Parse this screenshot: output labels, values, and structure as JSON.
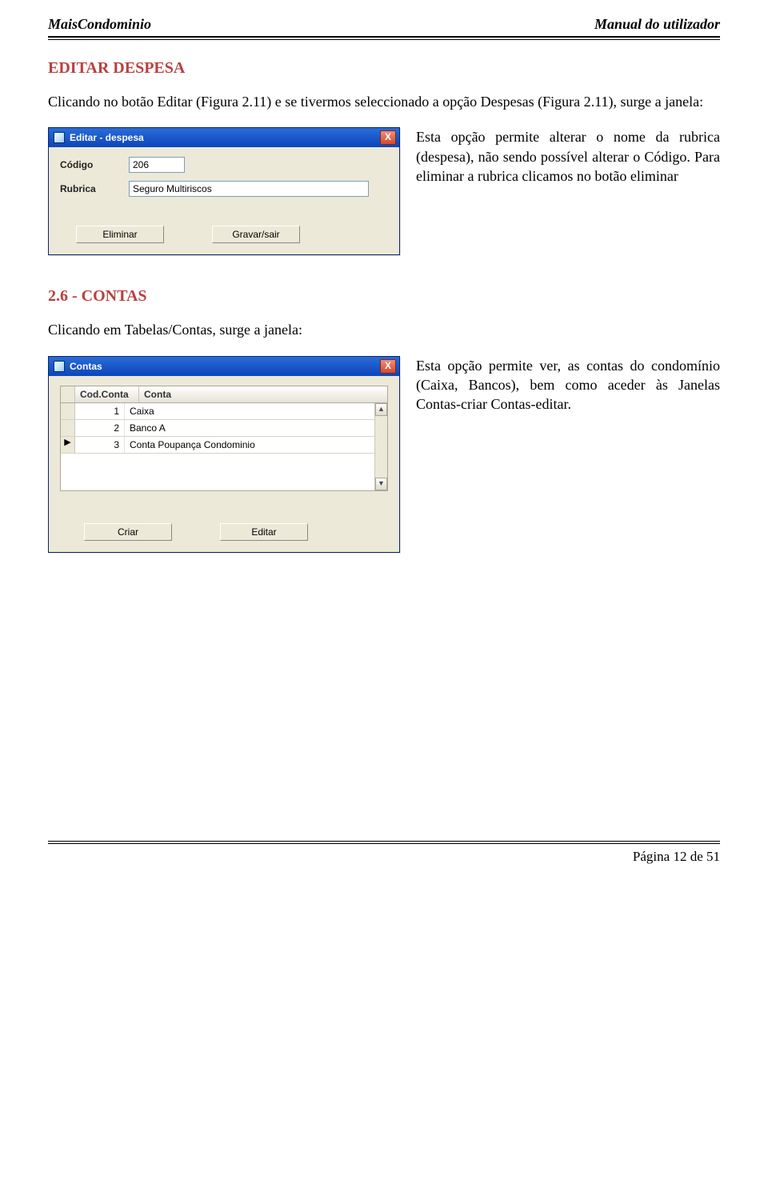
{
  "header": {
    "left": "MaisCondominio",
    "right": "Manual do utilizador"
  },
  "section1": {
    "title": "EDITAR DESPESA",
    "intro": "Clicando no botão Editar (Figura 2.11) e se tivermos seleccionado a opção Despesas (Figura 2.11), surge a janela:"
  },
  "editDialog": {
    "title": "Editar - despesa",
    "close_glyph": "X",
    "codigo_label": "Código",
    "codigo_value": "206",
    "rubrica_label": "Rubrica",
    "rubrica_value": "Seguro Multiriscos",
    "btn_eliminar": "Eliminar",
    "btn_gravar": "Gravar/sair"
  },
  "section1_side": "Esta opção permite alterar o nome da rubrica (despesa), não sendo possível alterar o Código.\nPara eliminar a rubrica clicamos no botão eliminar",
  "section2": {
    "title": "2.6 - CONTAS",
    "intro": "Clicando em Tabelas/Contas, surge a janela:"
  },
  "contasDialog": {
    "title": "Contas",
    "close_glyph": "X",
    "col_codigo": "Cod.Conta",
    "col_conta": "Conta",
    "rows": [
      {
        "sel": "",
        "cod": "1",
        "conta": "Caixa"
      },
      {
        "sel": "",
        "cod": "2",
        "conta": "Banco A"
      },
      {
        "sel": "▶",
        "cod": "3",
        "conta": "Conta Poupança Condominio"
      }
    ],
    "scroll_up": "▲",
    "scroll_down": "▼",
    "btn_criar": "Criar",
    "btn_editar": "Editar"
  },
  "section2_side": "Esta opção permite ver, as contas do condomínio (Caixa, Bancos), bem como aceder às Janelas Contas-criar Contas-editar.",
  "footer": {
    "page": "Página 12 de 51"
  }
}
